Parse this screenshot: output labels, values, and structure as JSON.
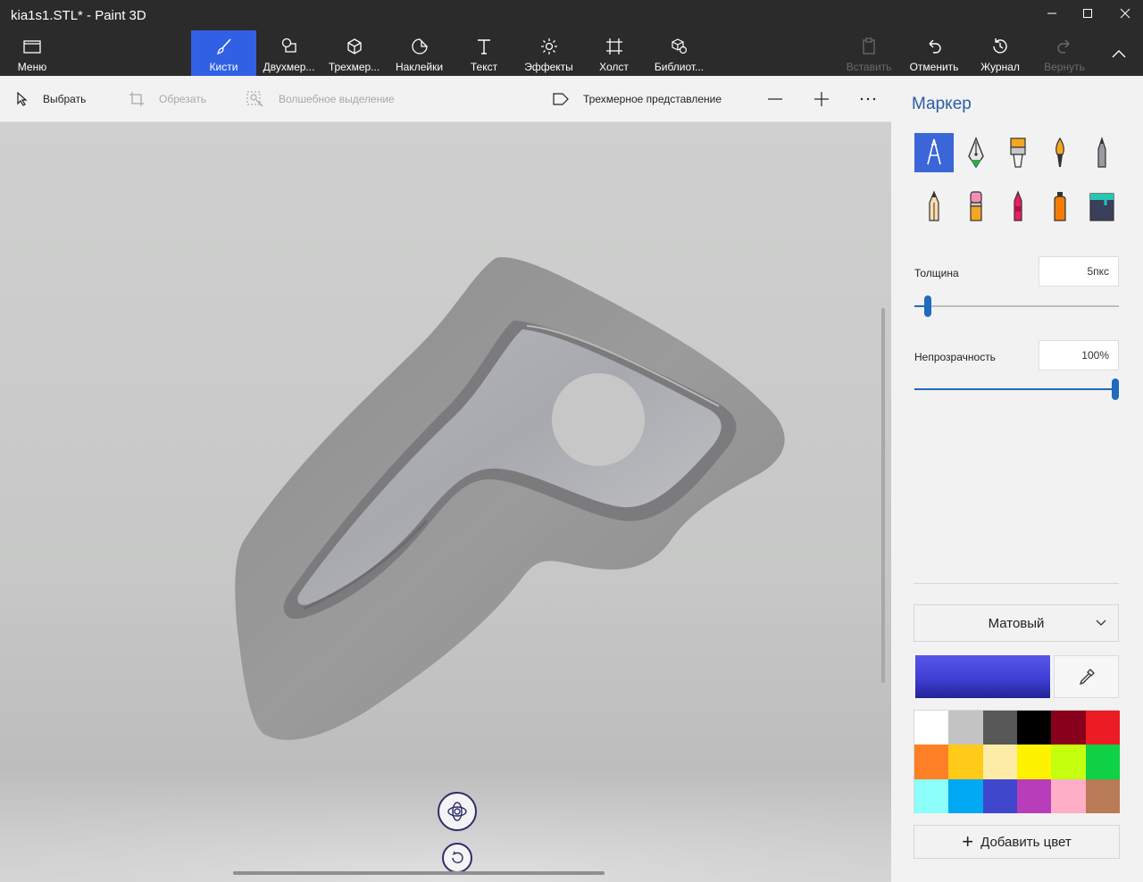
{
  "window": {
    "title": "kia1s1.STL* - Paint 3D"
  },
  "ribbon": {
    "tabs": [
      {
        "label": "Меню",
        "icon": "folder-icon"
      },
      {
        "label": "Кисти",
        "icon": "brush-icon",
        "active": true
      },
      {
        "label": "Двухмер...",
        "icon": "2d-shapes-icon"
      },
      {
        "label": "Трехмер...",
        "icon": "3d-shapes-icon"
      },
      {
        "label": "Наклейки",
        "icon": "sticker-icon"
      },
      {
        "label": "Текст",
        "icon": "text-icon"
      },
      {
        "label": "Эффекты",
        "icon": "effects-icon"
      },
      {
        "label": "Холст",
        "icon": "canvas-icon"
      },
      {
        "label": "Библиот...",
        "icon": "library-icon"
      }
    ],
    "actions": [
      {
        "label": "Вставить",
        "icon": "paste-icon",
        "enabled": false
      },
      {
        "label": "Отменить",
        "icon": "undo-icon",
        "enabled": true
      },
      {
        "label": "Журнал",
        "icon": "history-icon",
        "enabled": true
      },
      {
        "label": "Вернуть",
        "icon": "redo-icon",
        "enabled": false
      }
    ]
  },
  "toolbar": {
    "select": "Выбрать",
    "crop": "Обрезать",
    "magic_select": "Волшебное выделение",
    "view_3d": "Трехмерное представление"
  },
  "panel": {
    "title": "Маркер",
    "brushes": [
      {
        "name": "marker",
        "selected": true
      },
      {
        "name": "calligraphy-pen"
      },
      {
        "name": "oil-brush"
      },
      {
        "name": "watercolor"
      },
      {
        "name": "pixel-pen"
      },
      {
        "name": "pencil"
      },
      {
        "name": "eraser"
      },
      {
        "name": "crayon"
      },
      {
        "name": "spray-can"
      },
      {
        "name": "fill"
      }
    ],
    "thickness": {
      "label": "Толщина",
      "value": "5пкс",
      "level": 0.05
    },
    "opacity": {
      "label": "Непрозрачность",
      "value": "100%",
      "level": 1.0
    },
    "material": "Матовый",
    "current_color": "#3f3fd6",
    "palette": [
      "#ffffff",
      "#c3c3c3",
      "#585858",
      "#000000",
      "#88001b",
      "#ec1c24",
      "#ff7f27",
      "#ffca18",
      "#fdeca6",
      "#fff200",
      "#c4ff0e",
      "#0ed145",
      "#8cfffb",
      "#00a8f3",
      "#3f48cc",
      "#b83dba",
      "#ffaec8",
      "#b97a56"
    ],
    "add_color": "Добавить цвет"
  },
  "colors": {
    "accent": "#3061e4",
    "title_text": "#2d5ba8",
    "slider": "#1f6bbd"
  }
}
